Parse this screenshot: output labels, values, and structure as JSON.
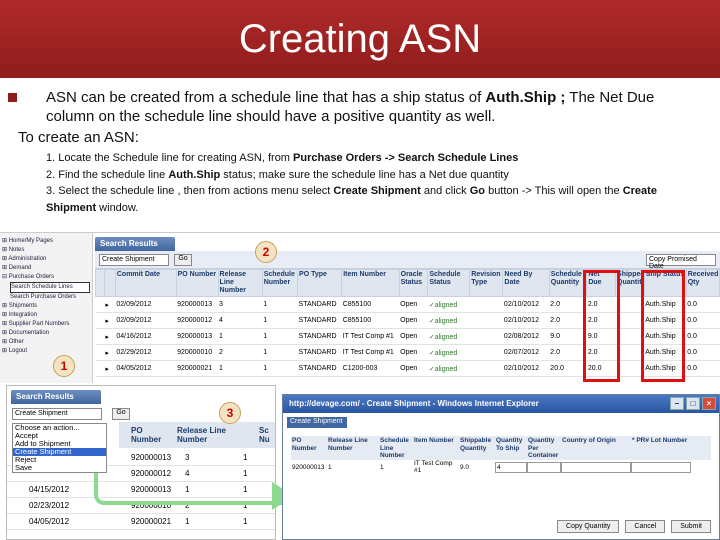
{
  "title": "Creating ASN",
  "bullet": {
    "pre": "ASN can be created from a schedule line that has a ship status of ",
    "bold": "Auth.Ship ;",
    "post": " The Net Due column on the schedule line should have a positive quantity as well."
  },
  "subhead": "To  create an ASN:",
  "steps": {
    "s1_pre": "1. Locate the  Schedule line for creating ASN, from ",
    "s1_bold": "Purchase Orders -> Search Schedule Lines",
    "s2_pre": "2. Find the schedule line ",
    "s2_bold": "Auth.Ship",
    "s2_post": " status; make sure the schedule line has a Net due quantity",
    "s3_pre": "3. Select the schedule line , then from actions menu select ",
    "s3_bold1": "Create Shipment",
    "s3_mid": " and click ",
    "s3_bold2": "Go",
    "s3_mid2": " button ->   This will open the ",
    "s3_bold3": "Create Shipment",
    "s3_post": " window."
  },
  "nav": {
    "items": [
      "⊞ Home/My Pages",
      "⊞ Notes",
      "⊞ Administration",
      "⊞ Demand",
      "⊟ Purchase Orders",
      "Search Schedule Lines",
      "Search Purchase Orders",
      "⊞ Shipments",
      "⊞ Integration",
      "⊞ Supplier Part Numbers",
      "⊞ Documentation",
      "⊞ Other",
      "⊞ Logout"
    ],
    "selected": "Search Schedule Lines"
  },
  "grid": {
    "header": "Search Results",
    "action_select": "Create Shipment",
    "go_label": "Go",
    "copy_select": "Copy Promised Date",
    "columns": [
      "",
      "",
      "Commit Date",
      "PO Number",
      "Release Line Number",
      "Schedule Number",
      "PO Type",
      "Item Number",
      "Oracle Status",
      "Schedule Status",
      "Revision Type",
      "Need By Date",
      "Schedule Quantity",
      "Net Due",
      "Shipped Quantity",
      "Ship Status",
      "Received Qty"
    ],
    "rows": [
      [
        "",
        "▸",
        "02/09/2012",
        "920000013",
        "3",
        "1",
        "STANDARD",
        "C855100",
        "Open",
        "✓aligned",
        "",
        "02/10/2012",
        "2.0",
        "2.0",
        "",
        "Auth.Ship",
        "0.0"
      ],
      [
        "",
        "▸",
        "02/09/2012",
        "920000012",
        "4",
        "1",
        "STANDARD",
        "C855100",
        "Open",
        "✓aligned",
        "",
        "02/10/2012",
        "2.0",
        "2.0",
        "",
        "Auth.Ship",
        "0.0"
      ],
      [
        "",
        "▸",
        "04/16/2012",
        "920000013",
        "1",
        "1",
        "STANDARD",
        "IT Test Comp #1",
        "Open",
        "✓aligned",
        "",
        "02/08/2012",
        "9.0",
        "9.0",
        "",
        "Auth.Ship",
        "0.0"
      ],
      [
        "",
        "▸",
        "02/29/2012",
        "920000010",
        "2",
        "1",
        "STANDARD",
        "IT Test Comp #1",
        "Open",
        "✓aligned",
        "",
        "02/07/2012",
        "2.0",
        "2.0",
        "",
        "Auth.Ship",
        "0.0"
      ],
      [
        "",
        "▸",
        "04/05/2012",
        "920000021",
        "1",
        "1",
        "STANDARD",
        "C1200-003",
        "Open",
        "✓aligned",
        "",
        "02/10/2012",
        "20.0",
        "20.0",
        "",
        "Auth.Ship",
        "0.0"
      ]
    ]
  },
  "callouts": {
    "one": "1",
    "two": "2",
    "three": "3"
  },
  "actions_panel": {
    "header": "Search Results",
    "select_value": "Create Shipment",
    "go_label": "Go",
    "menu": [
      "Choose an action...",
      "Accept",
      "Add to Shipment",
      "Create Shipment",
      "Reject",
      "Save"
    ],
    "menu_selected": "Create Shipment",
    "columns": [
      "PO Number",
      "Release Line Number",
      "Sc Nu"
    ],
    "rows": [
      [
        "",
        "920000013",
        "3",
        "1"
      ],
      [
        "",
        "920000012",
        "4",
        "1"
      ],
      [
        "04/15/2012",
        "920000013",
        "1",
        "1"
      ],
      [
        "02/23/2012",
        "920000010",
        "2",
        "1"
      ],
      [
        "04/05/2012",
        "920000021",
        "1",
        "1"
      ]
    ]
  },
  "window": {
    "title": "http://devage.com/ - Create Shipment - Windows Internet Explorer",
    "section": "Create Shipment",
    "columns": [
      "PO Number",
      "Release Line Number",
      "Schedule Line Number",
      "Item Number",
      "Shippable Quantity",
      "Quantity To Ship",
      "Quantity Per Container",
      "Country of Origin",
      "* PR# Lot Number"
    ],
    "row": [
      "920000013",
      "1",
      "1",
      "IT Test Comp #1",
      "9.0",
      "4",
      "",
      "",
      ""
    ],
    "buttons": [
      "Copy Quantity",
      "Cancel",
      "Submit"
    ]
  }
}
